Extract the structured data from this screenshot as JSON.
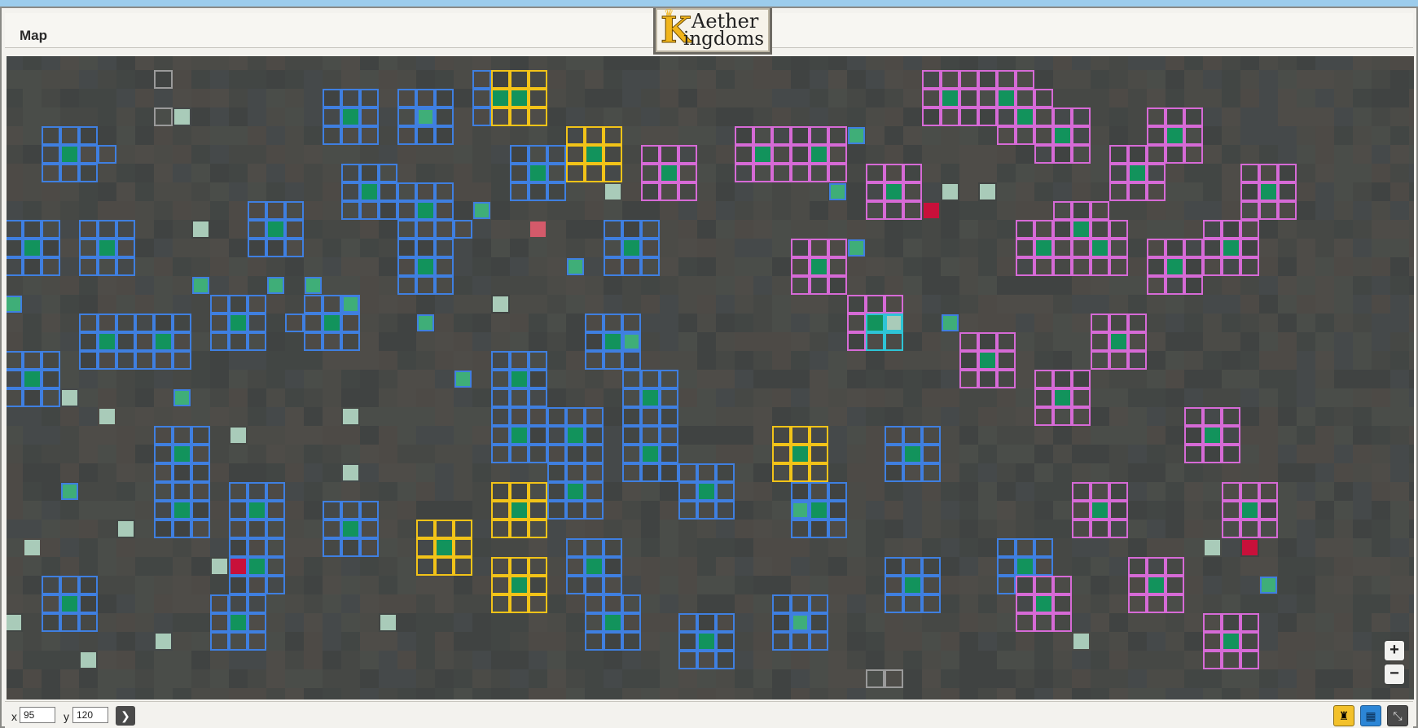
{
  "window": {
    "title": "Map"
  },
  "logo": {
    "line1": "Aether",
    "line2": "ingdoms",
    "initial": "K"
  },
  "coordinates": {
    "x_label": "x",
    "x_value": "95",
    "y_label": "y",
    "y_value": "120"
  },
  "icons": {
    "go": "arrow-right-icon",
    "zoom_in": "plus-icon",
    "zoom_out": "minus-icon",
    "tool_1": "castle-icon",
    "tool_2": "grid-icon",
    "tool_3": "collapse-icon"
  },
  "colors": {
    "alliance_blue": "#3f7fe0",
    "alliance_pink": "#d66ad6",
    "alliance_yellow": "#f2c318",
    "alliance_cyan": "#2ec4d6",
    "own_grey": "#9a9a9a",
    "castle_green": "#12935c",
    "outpost_light": "#a9cbb9",
    "enemy_red": "#c8103a",
    "ground": "#484a47"
  }
}
